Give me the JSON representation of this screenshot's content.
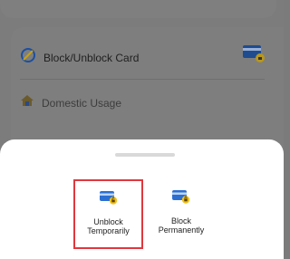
{
  "background": {
    "rows": [
      {
        "label": "Block/Unblock Card",
        "icon": "block-circle-icon"
      },
      {
        "label": "Domestic Usage",
        "icon": "home-icon"
      }
    ],
    "top_right_icon": "card-lock-icon"
  },
  "sheet": {
    "options": [
      {
        "label_line1": "Unblock",
        "label_line2": "Temporarily",
        "icon": "card-unlock-icon",
        "selected": true
      },
      {
        "label_line1": "Block",
        "label_line2": "Permanently",
        "icon": "card-lock-icon",
        "selected": false
      }
    ]
  },
  "colors": {
    "accent_yellow": "#f2c21b",
    "card_blue": "#2d6fd1",
    "selection_border": "#e0383e",
    "overlay": "#7c7c7c"
  }
}
